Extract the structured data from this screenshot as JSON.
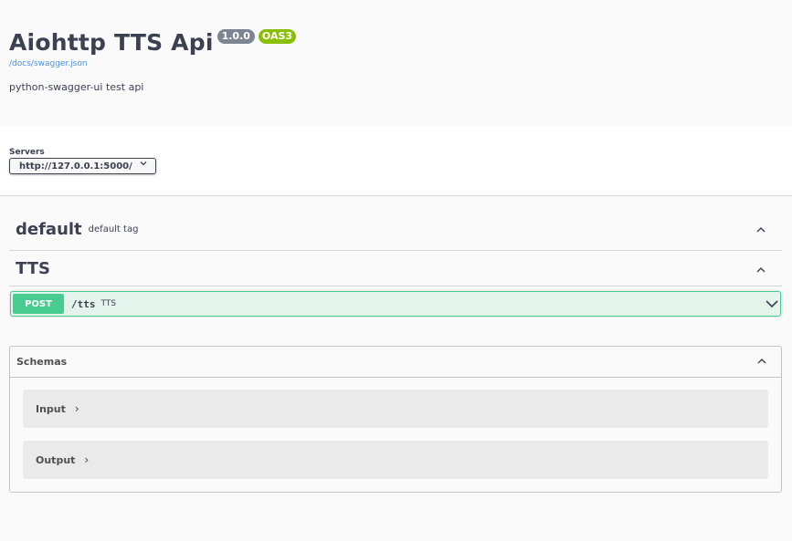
{
  "info": {
    "title": "Aiohttp TTS Api",
    "version": "1.0.0",
    "oas_badge": "OAS3",
    "spec_link": "/docs/swagger.json",
    "description": "python-swagger-ui test api"
  },
  "servers": {
    "label": "Servers",
    "selected": "http://127.0.0.1:5000/",
    "chevron_icon": "chevron-down-icon"
  },
  "tags": [
    {
      "name": "default",
      "description": "default tag",
      "expanded": true
    },
    {
      "name": "TTS",
      "description": "",
      "expanded": true
    }
  ],
  "operations": [
    {
      "method": "POST",
      "path": "/tts",
      "summary": "TTS",
      "expanded": false
    }
  ],
  "schemas": {
    "title": "Schemas",
    "expanded": true,
    "models": [
      {
        "name": "Input",
        "arrow": "›"
      },
      {
        "name": "Output",
        "arrow": "›"
      }
    ]
  },
  "colors": {
    "post": "#49cc90",
    "version_badge": "#7d8492",
    "oas_badge": "#89bf04",
    "link": "#4990e2",
    "text": "#3b4151"
  }
}
